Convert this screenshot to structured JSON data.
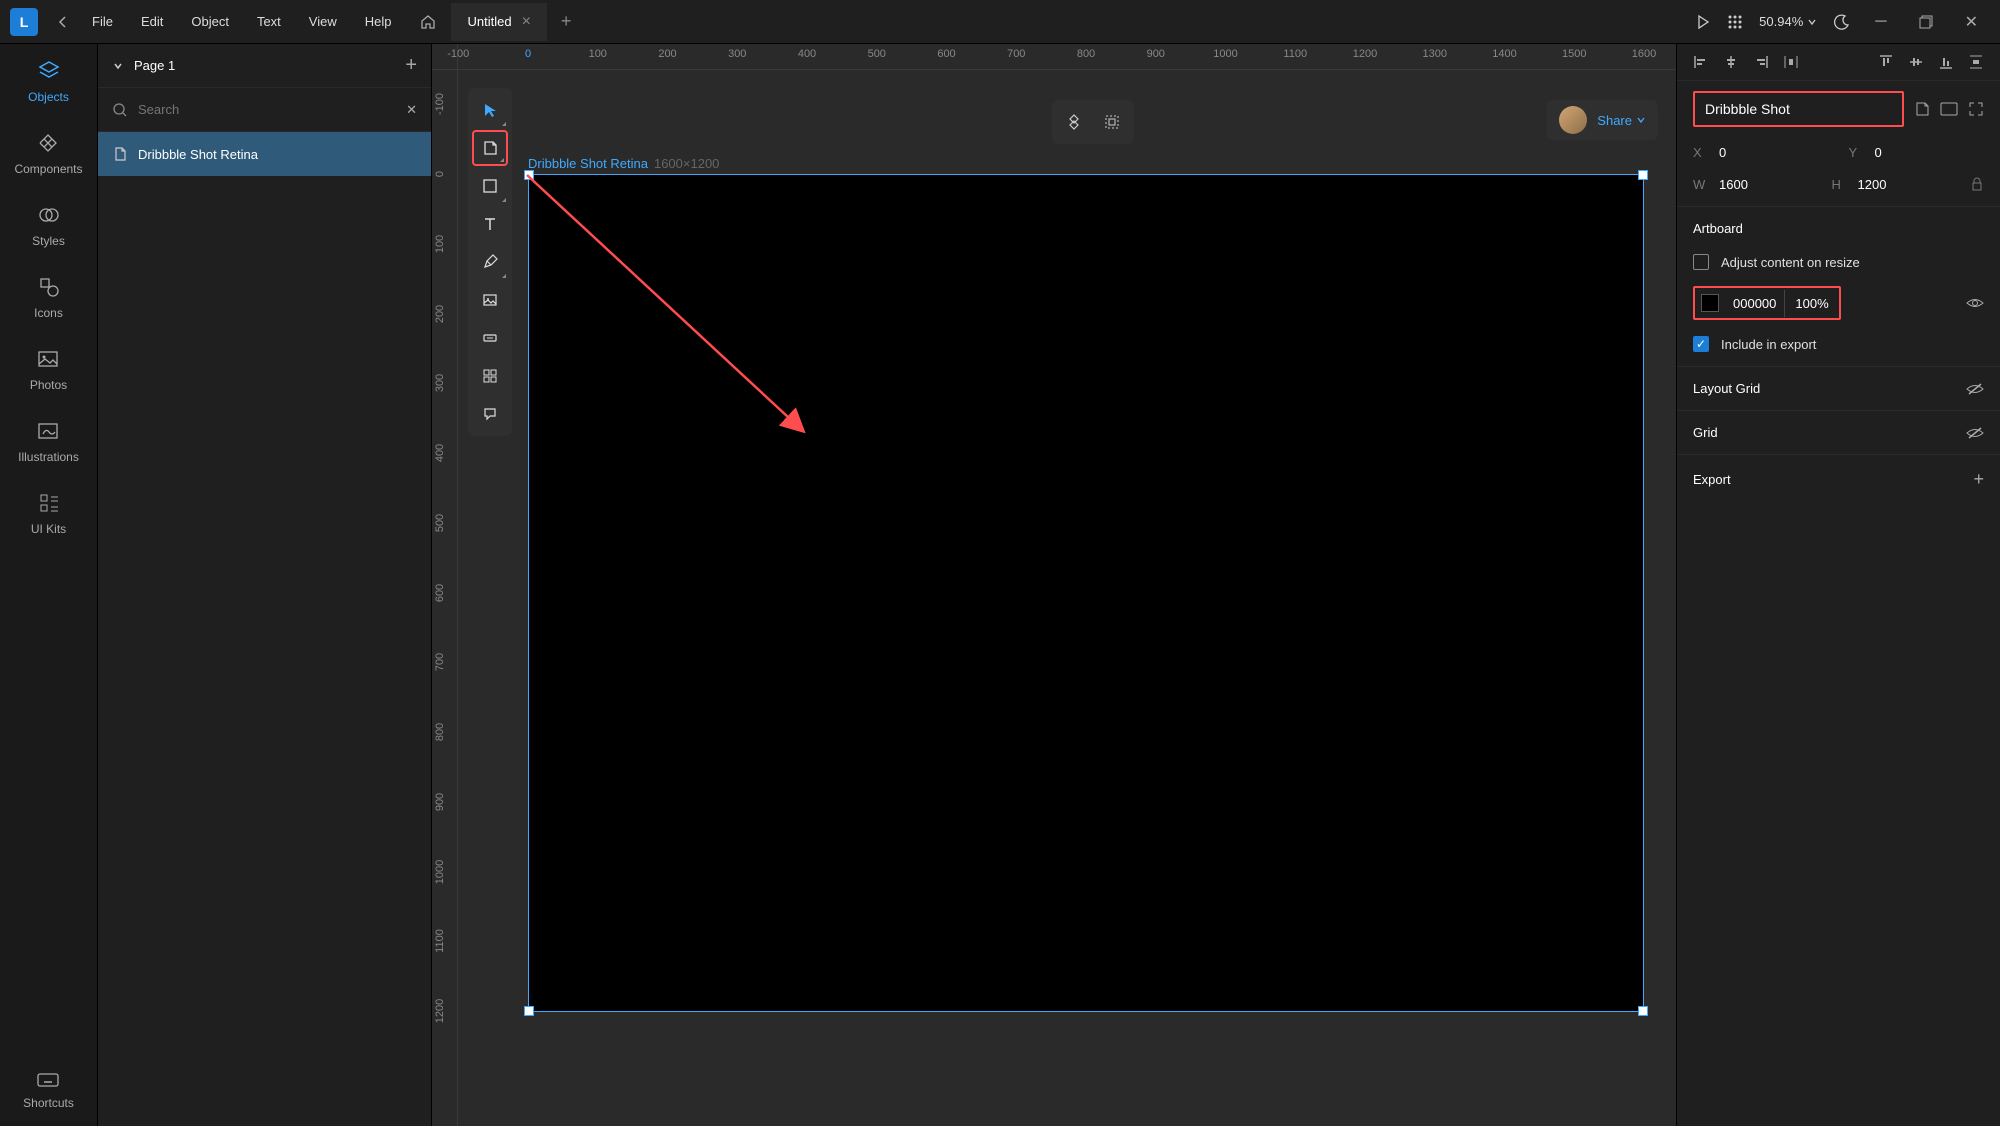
{
  "menubar": {
    "items": [
      "File",
      "Edit",
      "Object",
      "Text",
      "View",
      "Help"
    ],
    "tab_title": "Untitled",
    "zoom": "50.94%"
  },
  "rail": {
    "items": [
      {
        "label": "Objects",
        "icon": "layers"
      },
      {
        "label": "Components",
        "icon": "diamond"
      },
      {
        "label": "Styles",
        "icon": "circles"
      },
      {
        "label": "Icons",
        "icon": "shapes"
      },
      {
        "label": "Photos",
        "icon": "image"
      },
      {
        "label": "Illustrations",
        "icon": "illust"
      },
      {
        "label": "UI Kits",
        "icon": "uikit"
      }
    ],
    "footer": {
      "label": "Shortcuts",
      "icon": "keyboard"
    }
  },
  "left_panel": {
    "page_title": "Page 1",
    "search_placeholder": "Search",
    "layers": [
      {
        "name": "Dribbble Shot Retina",
        "type": "artboard"
      }
    ]
  },
  "canvas": {
    "ruler_h_ticks": [
      -100,
      0,
      100,
      200,
      300,
      400,
      500,
      600,
      700,
      800,
      900,
      1000,
      1100,
      1200,
      1300,
      1400,
      1500,
      1600
    ],
    "ruler_v_ticks": [
      -100,
      0,
      100,
      200,
      300,
      400,
      500,
      600,
      700,
      800,
      900,
      1000,
      1100,
      1200
    ],
    "artboard_name": "Dribbble Shot Retina",
    "artboard_dims": "1600×1200"
  },
  "toolbar": {
    "tools": [
      {
        "name": "select",
        "active": true
      },
      {
        "name": "artboard",
        "highlighted": true
      },
      {
        "name": "rectangle"
      },
      {
        "name": "text"
      },
      {
        "name": "pen"
      },
      {
        "name": "image"
      },
      {
        "name": "button"
      },
      {
        "name": "grid"
      },
      {
        "name": "comment"
      }
    ]
  },
  "share": {
    "label": "Share"
  },
  "inspector": {
    "name": "Dribbble Shot",
    "x_label": "X",
    "x": "0",
    "y_label": "Y",
    "y": "0",
    "w_label": "W",
    "w": "1600",
    "h_label": "H",
    "h": "1200",
    "artboard_section": "Artboard",
    "adjust_label": "Adjust content on resize",
    "adjust_checked": false,
    "fill_hex": "000000",
    "fill_opacity": "100%",
    "include_export_label": "Include in export",
    "include_export_checked": true,
    "layout_grid_label": "Layout Grid",
    "grid_label": "Grid",
    "export_label": "Export"
  }
}
